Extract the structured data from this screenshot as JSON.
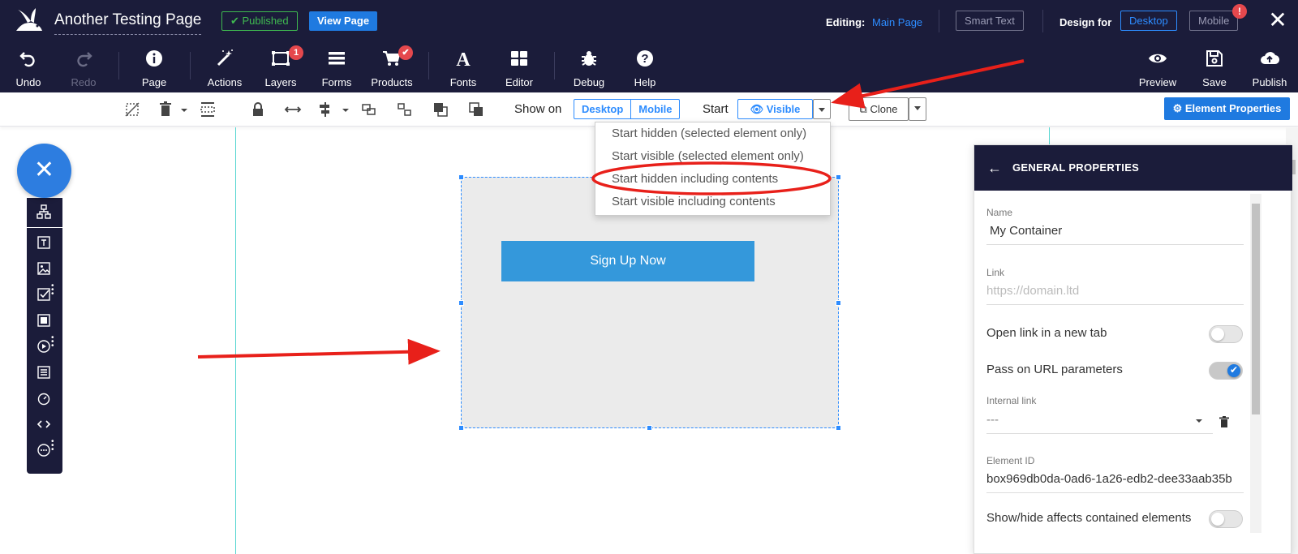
{
  "header": {
    "page_title": "Another Testing Page",
    "published_badge": "✔ Published",
    "view_page": "View Page",
    "editing_label": "Editing:",
    "editing_value": "Main Page",
    "smart_text": "Smart Text",
    "design_for": "Design for",
    "desktop": "Desktop",
    "mobile": "Mobile",
    "mobile_alert": "!",
    "close": "✕"
  },
  "tools": {
    "undo": "Undo",
    "redo": "Redo",
    "page": "Page",
    "actions": "Actions",
    "layers": "Layers",
    "layers_badge": "1",
    "forms": "Forms",
    "products": "Products",
    "fonts": "Fonts",
    "editor": "Editor",
    "debug": "Debug",
    "help": "Help",
    "preview": "Preview",
    "save": "Save",
    "publish": "Publish"
  },
  "toolbar2": {
    "show_on": "Show on",
    "desktop": "Desktop",
    "mobile": "Mobile",
    "start": "Start",
    "visible": "Visible",
    "clone": "Clone",
    "element_properties": "Element Properties"
  },
  "start_menu": {
    "items": [
      "Start hidden (selected element only)",
      "Start visible (selected element only)",
      "Start hidden including contents",
      "Start visible including contents"
    ]
  },
  "canvas": {
    "button_label": "Sign Up Now"
  },
  "properties": {
    "header": "GENERAL PROPERTIES",
    "name_label": "Name",
    "name_value": "My Container",
    "link_label": "Link",
    "link_placeholder": "https://domain.ltd",
    "open_new_tab": "Open link in a new tab",
    "open_new_tab_on": false,
    "pass_url_params": "Pass on URL parameters",
    "pass_url_params_on": true,
    "internal_link_label": "Internal link",
    "internal_link_value": "---",
    "element_id_label": "Element ID",
    "element_id_value": "box969db0da-0ad6-1a26-edb2-dee33aab35b",
    "show_hide_affects": "Show/hide affects contained elements",
    "show_hide_affects_on": false
  },
  "colors": {
    "topbar": "#1b1c3a",
    "accent": "#2d8cff",
    "primary_button": "#1f7ae0",
    "signup_button": "#3498db",
    "annotation": "#e8201a"
  }
}
